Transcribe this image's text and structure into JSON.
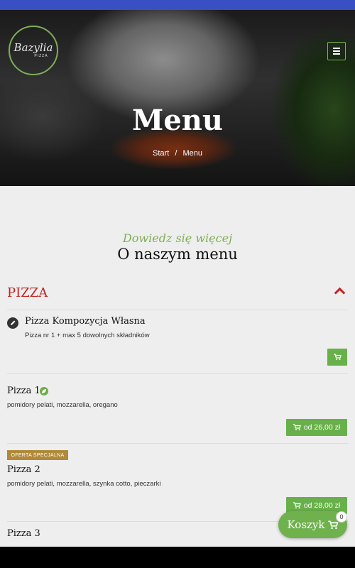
{
  "brand": {
    "logo_text": "Bazylia",
    "logo_sub": "PIZZA"
  },
  "hero": {
    "title": "Menu",
    "breadcrumb": {
      "home": "Start",
      "separator": "/",
      "current": "Menu"
    }
  },
  "section": {
    "eyebrow": "Dowiedz się więcej",
    "title": "O naszym menu"
  },
  "category": {
    "title": "PIZZA"
  },
  "items": [
    {
      "name": "Pizza Kompozycja Własna",
      "description": "Pizza nr 1 + max 5 dowolnych składników",
      "price": ""
    },
    {
      "name": "Pizza 1",
      "description": "pomidory pelati, mozzarella, oregano",
      "price": "od 26,00 zł"
    },
    {
      "name": "Pizza 2",
      "badge": "OFERTA SPECJALNA",
      "description": "pomidory pelati, mozzarella, szynka cotto, pieczarki",
      "price": "od 28,00 zł"
    },
    {
      "name": "Pizza 3"
    }
  ],
  "cart": {
    "label": "Koszyk",
    "count": "0"
  },
  "colors": {
    "accent_green": "#68b04a",
    "category_red": "#c42323",
    "badge_gold": "#b08a3a",
    "top_bar": "#3a4fc4"
  }
}
